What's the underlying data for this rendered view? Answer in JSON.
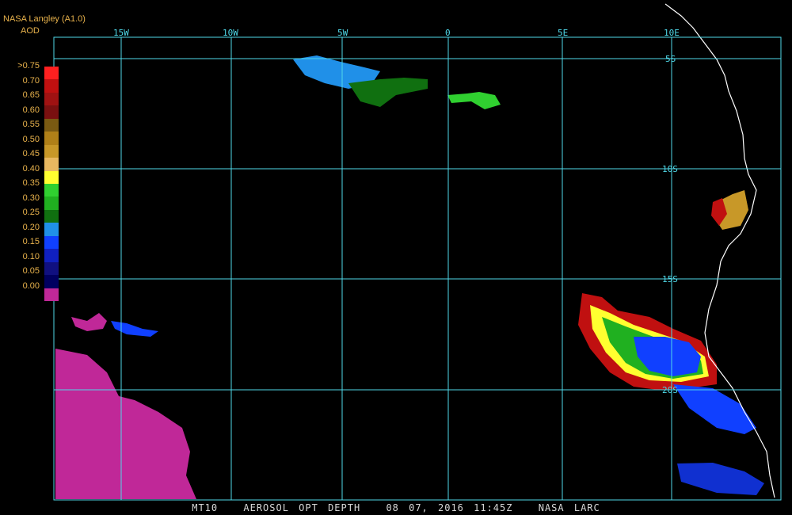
{
  "header": {
    "title": "NASA Langley (A1.0)",
    "quantity": "AOD"
  },
  "legend": {
    "labels": [
      ">0.75",
      "0.70",
      "0.65",
      "0.60",
      "0.55",
      "0.50",
      "0.45",
      "0.40",
      "0.35",
      "0.30",
      "0.25",
      "0.20",
      "0.15",
      "0.10",
      "0.05",
      "0.00"
    ],
    "colors": [
      "#ff2020",
      "#c01010",
      "#a01212",
      "#7a1010",
      "#7a5a12",
      "#b08018",
      "#c89828",
      "#e8b860",
      "#ffff30",
      "#30d030",
      "#20b020",
      "#107010",
      "#2090e8",
      "#1040ff",
      "#1020c0",
      "#101080",
      "#000060",
      "#c02898"
    ]
  },
  "grid": {
    "longitude_labels": [
      "15W",
      "10W",
      "5W",
      "0",
      "5E",
      "10E"
    ],
    "latitude_labels": [
      "5S",
      "10S",
      "15S",
      "20S"
    ],
    "line_color": "#4fd8e8"
  },
  "footer": {
    "product": "MT10",
    "field": "AEROSOL OPT DEPTH",
    "datetime": "08 07, 2016 11:45Z",
    "source": "NASA LARC"
  },
  "colors": {
    "background": "#000000",
    "coastline": "#ffffff",
    "label_text": "#e8b24c"
  }
}
